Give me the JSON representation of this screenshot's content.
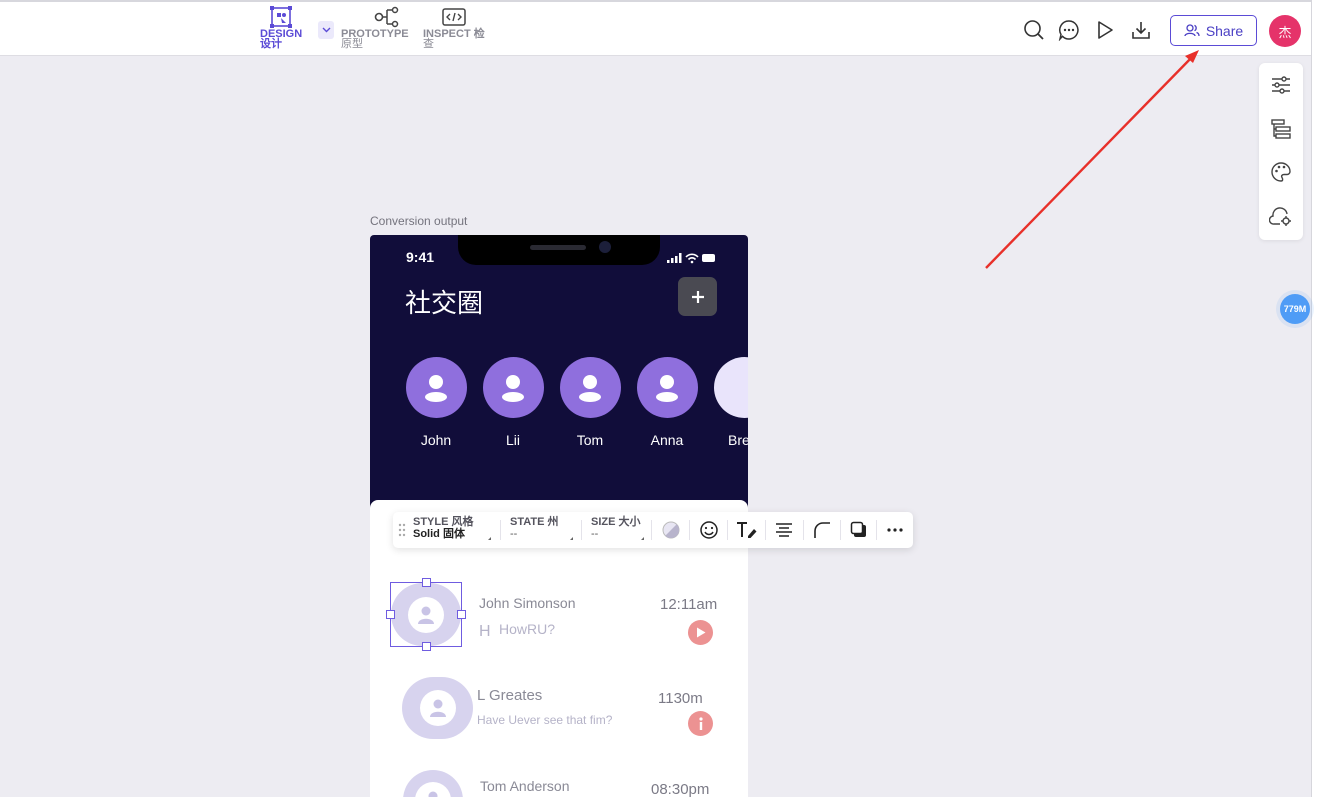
{
  "modes": [
    {
      "label": "DESIGN",
      "sub": "设计",
      "active": true
    },
    {
      "label": "PROTOTYPE",
      "sub": "原型",
      "active": false
    },
    {
      "label": "INSPECT 检",
      "sub": "查",
      "active": false
    }
  ],
  "header": {
    "share_label": "Share",
    "avatar_text": "杰"
  },
  "memory_badge": "779M",
  "frame": {
    "label": "Conversion output"
  },
  "phone": {
    "time": "9:41",
    "title": "社交圈",
    "stories": [
      "John",
      "Lii",
      "Tom",
      "Anna",
      "Bre"
    ],
    "chats": [
      {
        "name": "John Simonson",
        "initial": "H",
        "message": "HowRU?",
        "time": "12:11am",
        "badge": "play"
      },
      {
        "name": "L Greates",
        "initial": "",
        "message": "Have Uever see that fim?",
        "time": "1130m",
        "badge": "info"
      },
      {
        "name": "Tom Anderson",
        "initial": "",
        "message": "",
        "time": "08:30pm",
        "badge": ""
      }
    ]
  },
  "toolbar": {
    "style_label": "STYLE 风格",
    "style_value": "Solid 固体",
    "state_label": "STATE 州",
    "state_value": "--",
    "size_label": "SIZE 大小",
    "size_value": "--"
  },
  "colors": {
    "accent": "#5b4bd6",
    "phone_bg": "#110d3a",
    "story_circle": "#8f6fdd",
    "avatar": "#e5336a",
    "badge": "#ec9292",
    "memory_badge": "#4f9cf6",
    "annotation_arrow": "#e8302a"
  }
}
